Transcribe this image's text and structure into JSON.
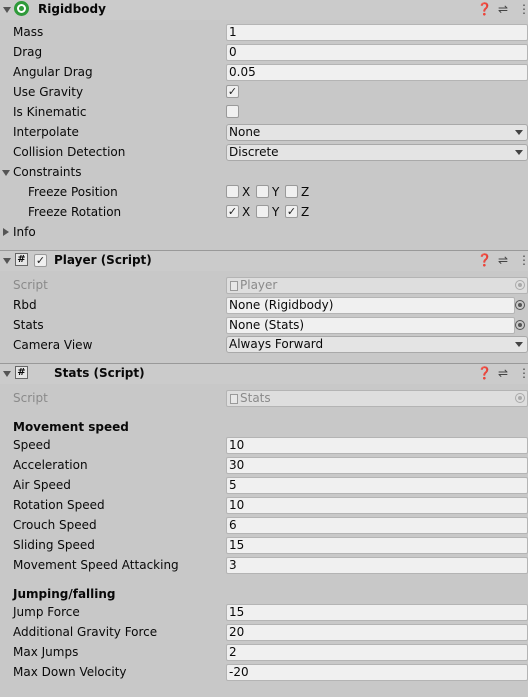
{
  "rigidbody": {
    "title": "Rigidbody",
    "mass_label": "Mass",
    "mass": "1",
    "drag_label": "Drag",
    "drag": "0",
    "angular_drag_label": "Angular Drag",
    "angular_drag": "0.05",
    "use_gravity_label": "Use Gravity",
    "use_gravity": true,
    "is_kinematic_label": "Is Kinematic",
    "is_kinematic": false,
    "interpolate_label": "Interpolate",
    "interpolate": "None",
    "collision_label": "Collision Detection",
    "collision": "Discrete",
    "constraints_label": "Constraints",
    "freeze_position_label": "Freeze Position",
    "freeze_rotation_label": "Freeze Rotation",
    "axis_x": "X",
    "axis_y": "Y",
    "axis_z": "Z",
    "freeze_position": {
      "x": false,
      "y": false,
      "z": false
    },
    "freeze_rotation": {
      "x": true,
      "y": false,
      "z": true
    },
    "info_label": "Info"
  },
  "player": {
    "title": "Player (Script)",
    "enabled": true,
    "script_label": "Script",
    "script": "Player",
    "rbd_label": "Rbd",
    "rbd": "None (Rigidbody)",
    "stats_label": "Stats",
    "stats": "None (Stats)",
    "camera_label": "Camera View",
    "camera": "Always Forward"
  },
  "stats": {
    "title": "Stats (Script)",
    "script_label": "Script",
    "script": "Stats",
    "movement_header": "Movement speed",
    "speed_label": "Speed",
    "speed": "10",
    "acceleration_label": "Acceleration",
    "acceleration": "30",
    "air_speed_label": "Air Speed",
    "air_speed": "5",
    "rotation_speed_label": "Rotation Speed",
    "rotation_speed": "10",
    "crouch_speed_label": "Crouch Speed",
    "crouch_speed": "6",
    "sliding_speed_label": "Sliding Speed",
    "sliding_speed": "15",
    "attacking_label": "Movement Speed Attacking",
    "attacking": "3",
    "jumping_header": "Jumping/falling",
    "jump_force_label": "Jump Force",
    "jump_force": "15",
    "gravity_label": "Additional Gravity Force",
    "gravity": "20",
    "max_jumps_label": "Max Jumps",
    "max_jumps": "2",
    "max_down_label": "Max Down Velocity",
    "max_down": "-20"
  },
  "icons": {
    "help": "help-icon",
    "presets": "presets-icon",
    "menu": "kebab-menu-icon",
    "rigidbody": "rigidbody-icon",
    "script": "script-hash-icon"
  },
  "colors": {
    "header": "#cbcbcb",
    "background": "#c8c8c8",
    "field": "#f0f0f0",
    "rigidbody_icon": "#2f9a3a"
  }
}
